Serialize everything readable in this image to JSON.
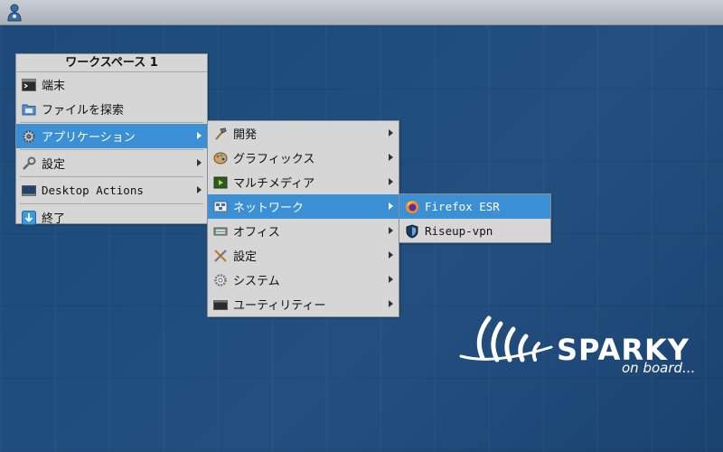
{
  "desktop": {
    "logo_text": "SPARKY",
    "logo_subtext": "on board..."
  },
  "root_menu": {
    "title": "ワークスペース 1",
    "items": [
      {
        "label": "端末",
        "icon": "terminal-icon"
      },
      {
        "label": "ファイルを探索",
        "icon": "folder-icon"
      },
      {
        "label": "アプリケーション",
        "icon": "gear-icon",
        "submenu": true,
        "active": true
      },
      {
        "label": "設定",
        "icon": "wrench-icon",
        "submenu": true
      },
      {
        "label": "Desktop Actions",
        "icon": "desktop-icon",
        "submenu": true
      },
      {
        "label": "終了",
        "icon": "exit-icon"
      }
    ]
  },
  "apps_menu": {
    "items": [
      {
        "label": "開発",
        "icon": "hammer-icon"
      },
      {
        "label": "グラフィックス",
        "icon": "palette-icon"
      },
      {
        "label": "マルチメディア",
        "icon": "film-icon"
      },
      {
        "label": "ネットワーク",
        "icon": "network-icon",
        "active": true
      },
      {
        "label": "オフィス",
        "icon": "office-icon"
      },
      {
        "label": "設定",
        "icon": "tools-icon"
      },
      {
        "label": "システム",
        "icon": "system-gear-icon"
      },
      {
        "label": "ユーティリティー",
        "icon": "utility-icon"
      }
    ]
  },
  "network_menu": {
    "items": [
      {
        "label": "Firefox ESR",
        "icon": "firefox-icon",
        "active": true
      },
      {
        "label": "Riseup-vpn",
        "icon": "shield-icon"
      }
    ]
  },
  "colors": {
    "highlight": "#3b8fd4",
    "menu_bg": "#d6d6d6",
    "desktop_bg": "#1f4e7e"
  }
}
